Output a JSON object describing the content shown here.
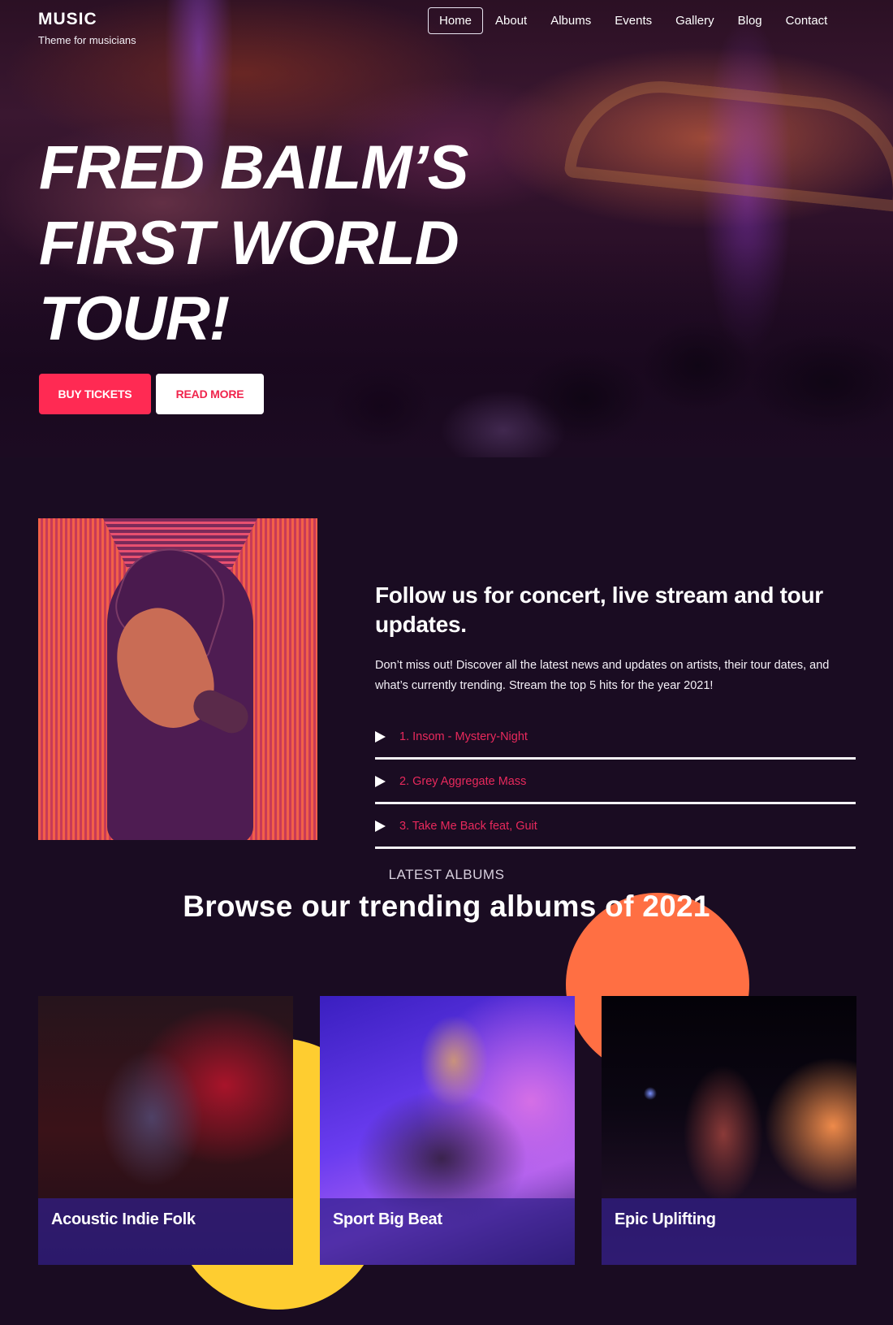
{
  "site": {
    "title": "MUSIC",
    "tagline": "Theme for musicians"
  },
  "nav": {
    "items": [
      {
        "label": "Home",
        "active": true
      },
      {
        "label": "About",
        "active": false
      },
      {
        "label": "Albums",
        "active": false
      },
      {
        "label": "Events",
        "active": false
      },
      {
        "label": "Gallery",
        "active": false
      },
      {
        "label": "Blog",
        "active": false
      },
      {
        "label": "Contact",
        "active": false
      }
    ]
  },
  "hero": {
    "headline_lines": [
      "FRED BAILM’S",
      "FIRST WORLD",
      "TOUR!"
    ],
    "primary_button": "BUY TICKETS",
    "secondary_button": "READ MORE"
  },
  "follow": {
    "title": "Follow us for concert, live stream and tour updates.",
    "body": "Don’t miss out! Discover all the latest news and updates on artists, their tour dates, and what’s currently trending. Stream the top 5 hits for the year 2021!",
    "tracks": [
      {
        "label": "1. Insom - Mystery-Night"
      },
      {
        "label": "2. Grey Aggregate Mass"
      },
      {
        "label": "3. Take Me Back feat, Guit"
      }
    ]
  },
  "albums": {
    "kicker": "LATEST ALBUMS",
    "title": "Browse our trending albums of 2021",
    "items": [
      {
        "title": "Acoustic Indie Folk"
      },
      {
        "title": "Sport Big Beat"
      },
      {
        "title": "Epic Uplifting"
      }
    ]
  },
  "colors": {
    "background": "#1a0c22",
    "accent": "#ff2a53",
    "track_text": "#e8295c",
    "circle_orange": "#ff6f43",
    "circle_yellow": "#fecd30",
    "caption_overlay": "#3a24a0"
  }
}
